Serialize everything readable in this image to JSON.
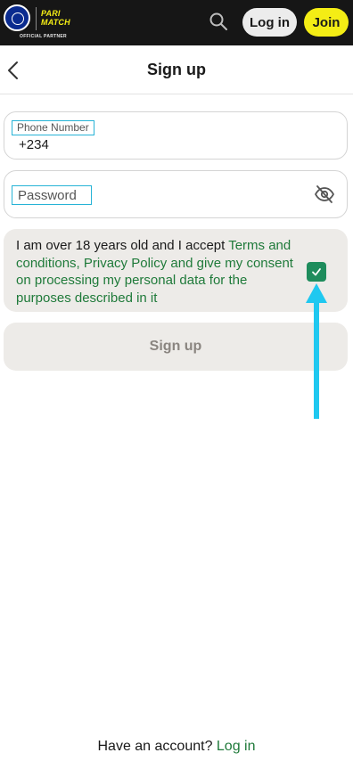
{
  "header": {
    "brand_line1": "PARI",
    "brand_line2": "MATCH",
    "partner_text": "OFFICIAL PARTNER",
    "login_label": "Log in",
    "join_label": "Join",
    "search_icon": "search-icon"
  },
  "subheader": {
    "title": "Sign up",
    "back_icon": "chevron-left-icon"
  },
  "form": {
    "phone_label": "Phone Number",
    "phone_value": "+234",
    "password_placeholder": "Password",
    "eye_icon": "eye-off-icon"
  },
  "consent": {
    "text_prefix": "I am over 18 years old and I accept ",
    "link_text": "Terms and conditions, Privacy Policy and give my consent on processing my personal data for the purposes described in it",
    "checked": true
  },
  "submit": {
    "label": "Sign up"
  },
  "footer": {
    "prompt": "Have an account? ",
    "login_link": "Log in"
  },
  "colors": {
    "header_bg": "#161616",
    "brand_yellow": "#f4ed15",
    "link_green": "#1f7a3a",
    "checkbox_green": "#1e8c5c",
    "annotation_arrow": "#1fc8f0"
  }
}
